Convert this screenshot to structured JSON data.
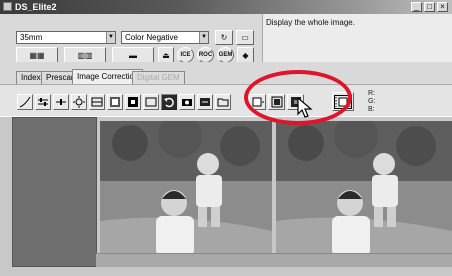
{
  "window": {
    "title": "DS_Elite2",
    "minimize": "_",
    "maximize": "□",
    "close": "×"
  },
  "controls": {
    "size_combo": "35mm",
    "film_combo": "Color Negative",
    "status_text": "Display the whole image."
  },
  "tabs": [
    {
      "label": "Index"
    },
    {
      "label": "Prescan"
    },
    {
      "label": "Image Correction"
    },
    {
      "label": "Digital GEM"
    }
  ],
  "toolbar": {
    "rgb_labels": [
      "R:",
      "G:",
      "B:"
    ]
  },
  "badges": {
    "ice": "ICE",
    "roc": "ROC",
    "gem": "GEM"
  },
  "colors": {
    "highlight": "#e0142a",
    "titlebar": "#3a3a3a"
  }
}
